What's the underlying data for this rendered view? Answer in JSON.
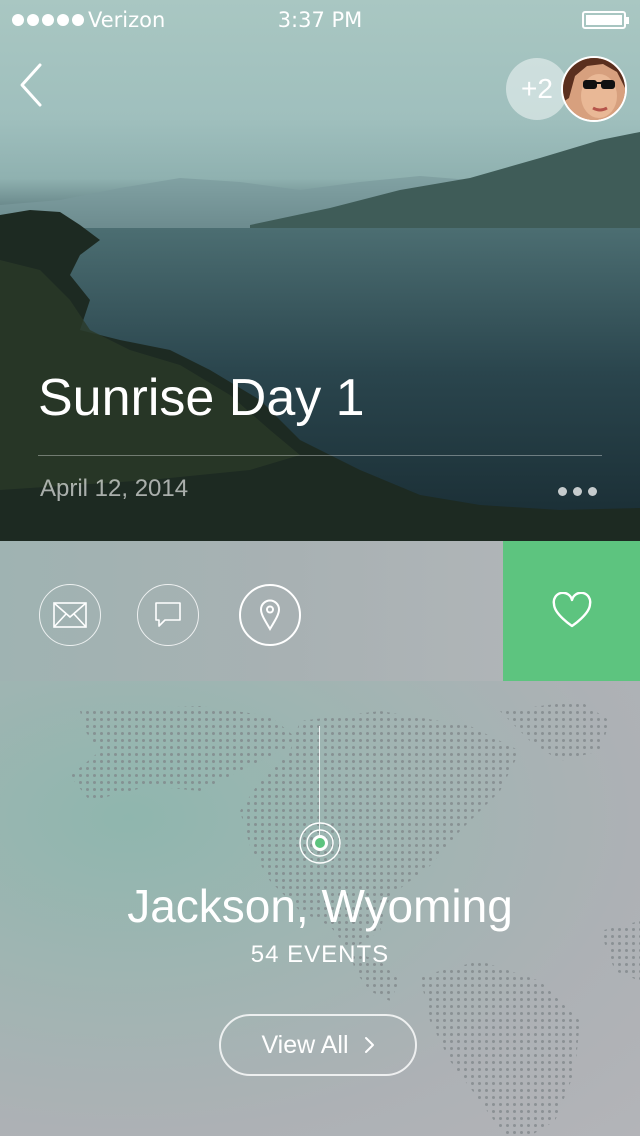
{
  "status_bar": {
    "carrier": "Verizon",
    "time": "3:37 PM"
  },
  "header": {
    "extra_participants": "+2"
  },
  "post": {
    "title": "Sunrise Day 1",
    "date": "April 12, 2014"
  },
  "actions": {
    "items": [
      {
        "icon": "mail-icon"
      },
      {
        "icon": "comment-icon"
      },
      {
        "icon": "location-pin-icon",
        "active": true
      }
    ],
    "like_icon": "heart-icon",
    "like_color": "#5dc47f"
  },
  "location": {
    "name": "Jackson, Wyoming",
    "events": "54 EVENTS",
    "button_label": "View All",
    "button_icon": "chevron-right-icon"
  }
}
